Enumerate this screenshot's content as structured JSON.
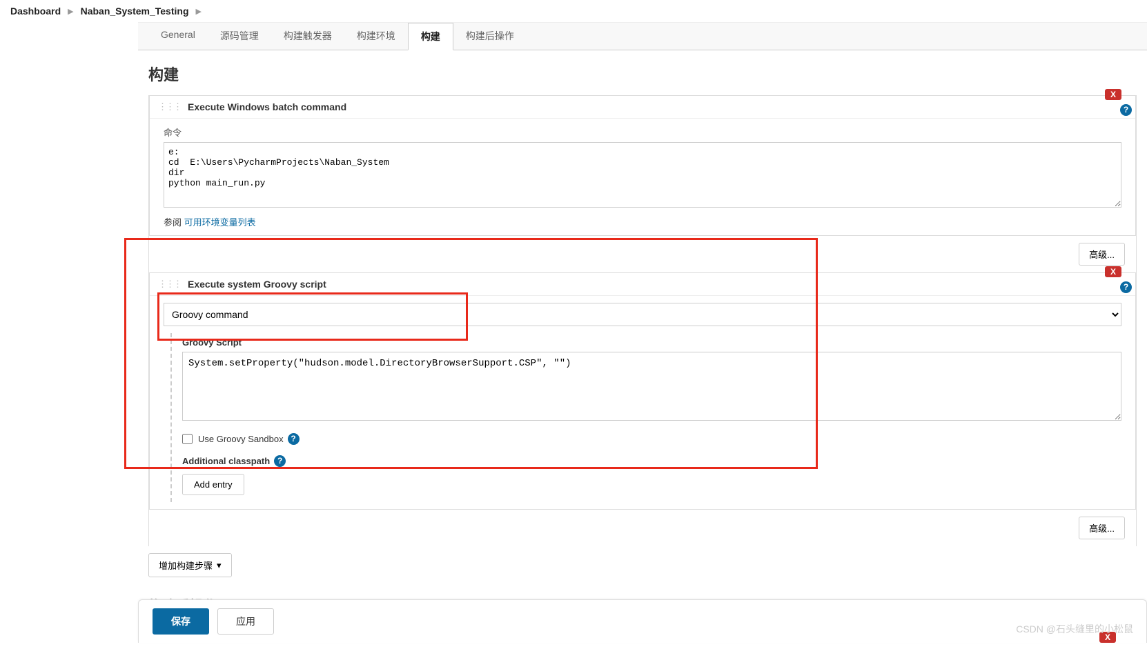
{
  "breadcrumb": {
    "dashboard": "Dashboard",
    "job": "Naban_System_Testing"
  },
  "tabs": {
    "general": "General",
    "scm": "源码管理",
    "triggers": "构建触发器",
    "env": "构建环境",
    "build": "构建",
    "post": "构建后操作"
  },
  "section_title": "构建",
  "step1": {
    "title": "Execute Windows batch command",
    "cmd_label": "命令",
    "cmd_value": "e:\ncd  E:\\Users\\PycharmProjects\\Naban_System\ndir\npython main_run.py",
    "ref_prefix": "参阅 ",
    "ref_link": "可用环境变量列表",
    "advanced": "高级..."
  },
  "step2": {
    "title": "Execute system Groovy script",
    "select_value": "Groovy command",
    "script_label": "Groovy Script",
    "script_value": "System.setProperty(\"hudson.model.DirectoryBrowserSupport.CSP\", \"\")",
    "sandbox_label": "Use Groovy Sandbox",
    "classpath_label": "Additional classpath",
    "add_entry": "Add entry",
    "advanced": "高级..."
  },
  "add_step": "增加构建步骤",
  "next_section_title": "构建后操作",
  "buttons": {
    "save": "保存",
    "apply": "应用"
  },
  "delete_x": "X",
  "help_q": "?",
  "caret": "▾",
  "watermark": "CSDN @石头缝里的小松鼠"
}
